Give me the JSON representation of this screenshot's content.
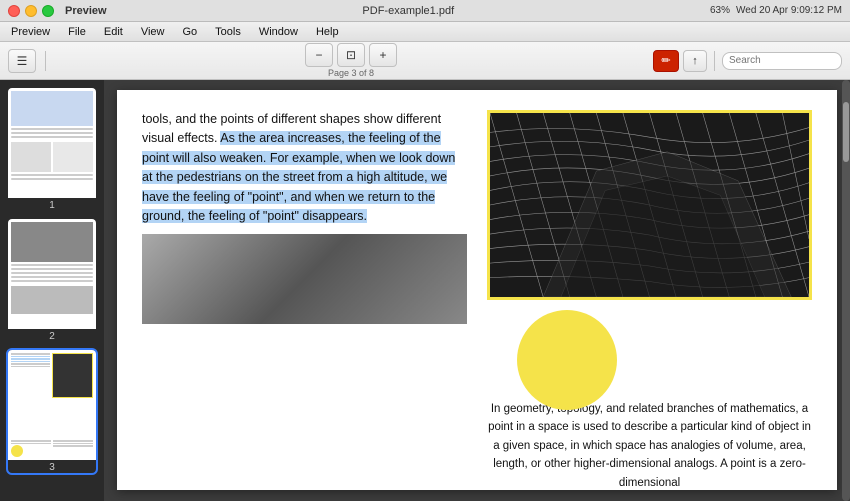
{
  "window": {
    "title": "Preview",
    "app": "Preview"
  },
  "titlebar": {
    "filename": "PDF-example1.pdf",
    "page_info": "Page 3 of 8"
  },
  "menubar": {
    "items": [
      "Preview",
      "File",
      "Edit",
      "View",
      "Go",
      "Tools",
      "Window",
      "Help"
    ]
  },
  "toolbar": {
    "sidebar_toggle": "☰",
    "zoom_out": "−",
    "zoom_in": "+",
    "fit_width": "⊡",
    "pencil_label": "✏",
    "share_label": "↑",
    "search_placeholder": "Search"
  },
  "status_bar": {
    "datetime": "Wed 20 Apr  9:09:12 PM",
    "battery": "63%",
    "wifi": "wifi"
  },
  "sidebar": {
    "pages": [
      {
        "num": "1"
      },
      {
        "num": "2"
      },
      {
        "num": "3",
        "active": true
      }
    ]
  },
  "pdf": {
    "left_col": {
      "intro": "tools, and the points of different shapes show different visual effects. ",
      "highlighted": "As the area increases, the feeling of the point will also weaken. For example, when we look down at the pedestrians on the street from a high altitude, we have the feeling of \"point\", and when we return to the ground, the feeling of \"point\" disappears."
    },
    "right_col": {
      "geo_text": "In geometry, topology, and related branches of mathematics, a point in a space is used to describe a particular kind of object in a given space, in which space has analogies of volume, area, length, or other higher-dimensional analogs. A point is a zero-dimensional"
    }
  }
}
